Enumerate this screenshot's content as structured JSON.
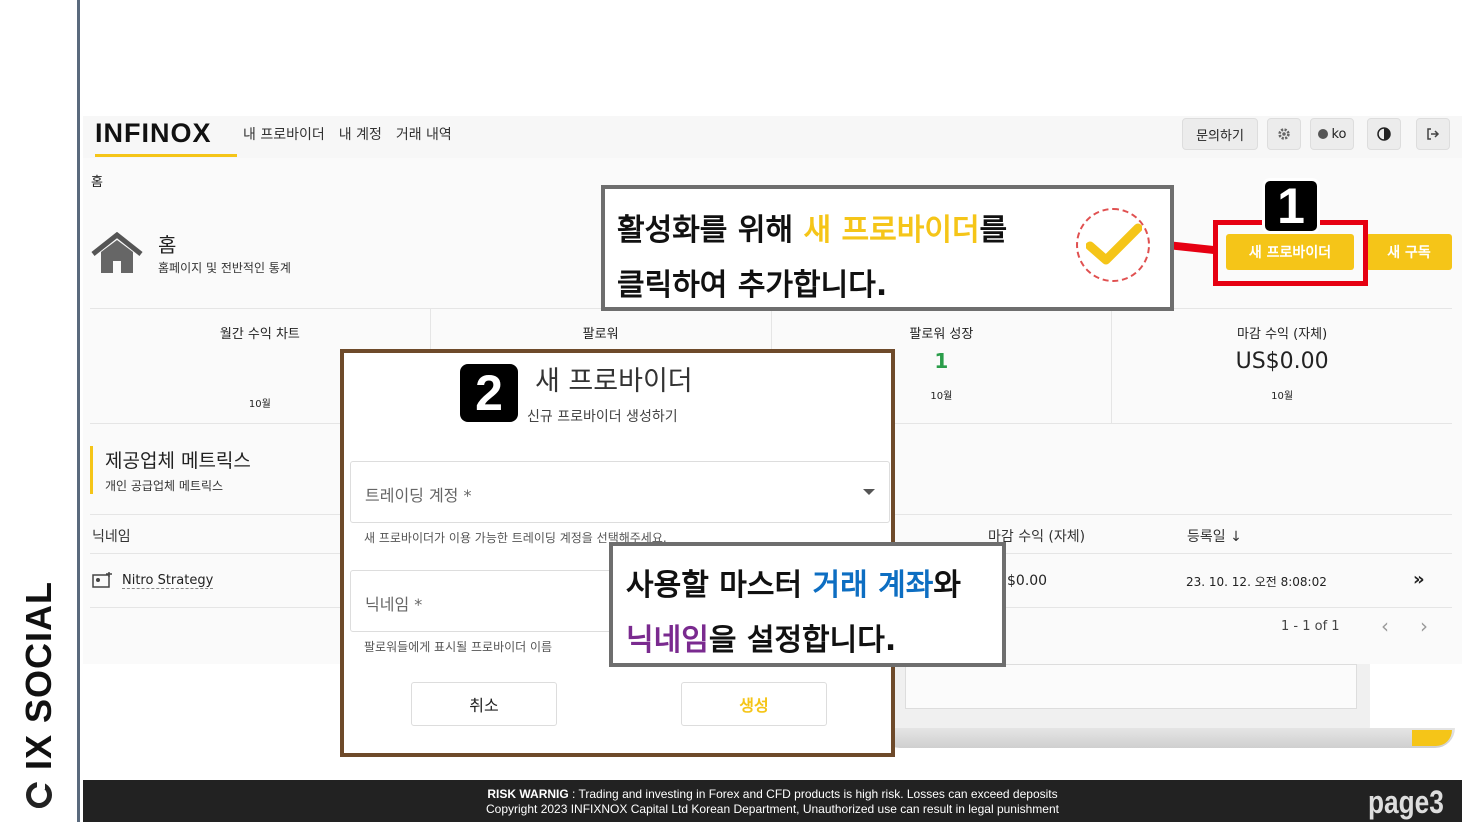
{
  "brand": {
    "vertical_text": "IX SOCIAL"
  },
  "app": {
    "logo": "INFINOX",
    "nav": [
      "내 프로바이더",
      "내 계정",
      "거래 내역"
    ],
    "toolbar": {
      "contact": "문의하기",
      "lang": "ko"
    },
    "breadcrumb": "홈",
    "home": {
      "title": "홈",
      "subtitle": "홈페이지 및 전반적인 통계"
    },
    "buttons": {
      "new_provider": "새 프로바이더",
      "new_subscription": "새 구독"
    },
    "stats": [
      {
        "label": "월간 수익 차트",
        "value": "",
        "month": "10월"
      },
      {
        "label": "팔로워",
        "value": "",
        "month": ""
      },
      {
        "label": "팔로워 성장",
        "value": "1",
        "month": "10월"
      },
      {
        "label": "마감 수익 (자체)",
        "value": "US$0.00",
        "month": "10월"
      }
    ],
    "metrics": {
      "title": "제공업체 메트릭스",
      "subtitle": "개인 공급업체 메트릭스"
    },
    "table": {
      "headers": {
        "nickname": "닉네임",
        "closed_profit": "마감 수익 (자체)",
        "registered": "등록일"
      },
      "rows": [
        {
          "nickname": "Nitro Strategy",
          "profit": "$0.00",
          "date": "23. 10. 12. 오전 8:08:02"
        }
      ],
      "pagination": "1 - 1 of 1"
    }
  },
  "modal": {
    "badge": "2",
    "title": "새 프로바이더",
    "subtitle": "신규 프로바이더 생성하기",
    "account_field": {
      "placeholder": "트레이딩 계정 *",
      "hint": "새 프로바이더가 이용 가능한 트레이딩 계정을 선택해주세요."
    },
    "nickname_field": {
      "placeholder": "닉네임 *",
      "hint": "팔로워들에게 표시될 프로바이더 이름"
    },
    "cancel": "취소",
    "create": "생성"
  },
  "callout1": {
    "badge": "1",
    "line1_a": "활성화를 위해 ",
    "line1_hl": "새 프로바이더",
    "line1_b": "를",
    "line2": "클릭하여 추가합니다."
  },
  "callout2": {
    "line1_a": "사용할 마스터 ",
    "line1_hl": "거래 계좌",
    "line1_b": "와",
    "line2_hl": "닉네임",
    "line2_b": "을 설정합니다."
  },
  "footer": {
    "warning_label": "RISK WARNIG",
    "warning_text": " : Trading and investing in Forex and CFD products is high risk. Losses can exceed deposits",
    "copyright": "Copyright 2023 INFIXNOX Capital Ltd Korean Department, Unauthorized use can result in legal punishment"
  },
  "page_number": "page3",
  "colors": {
    "accent": "#f5c518",
    "highlight_red": "#e60012",
    "modal_border": "#6e4a2a",
    "blue": "#0d6ec2",
    "purple": "#7a2a8f"
  }
}
